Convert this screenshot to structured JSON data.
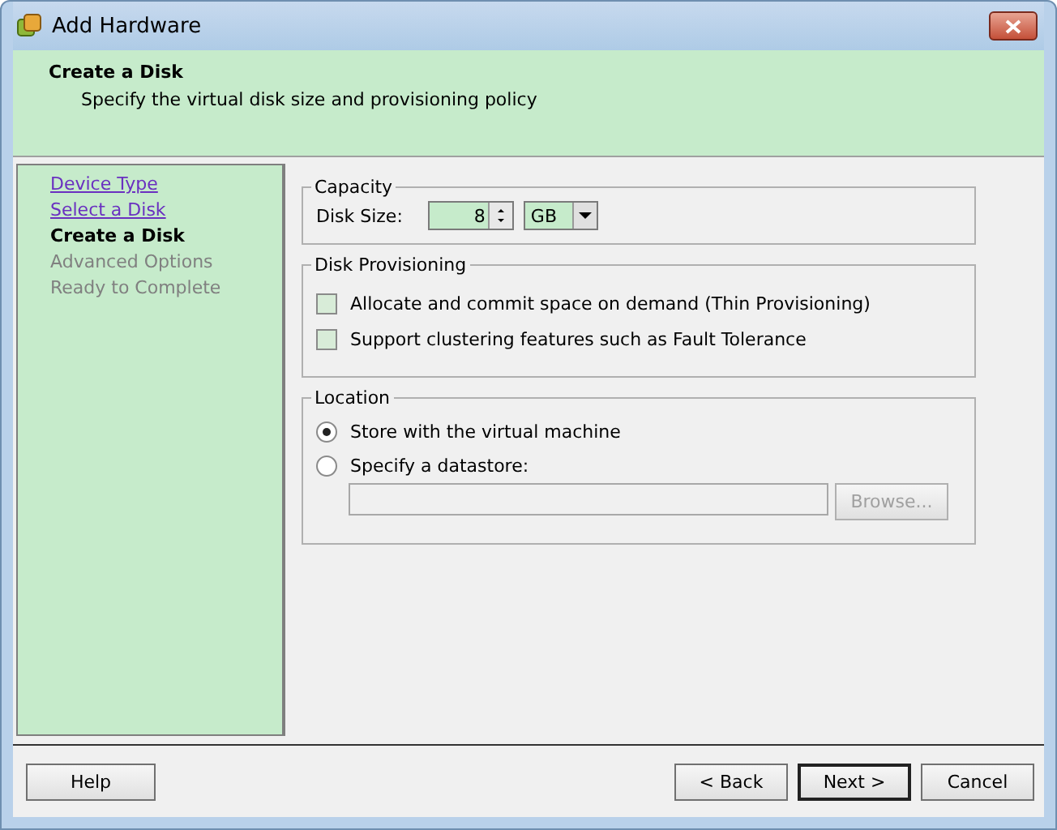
{
  "window": {
    "title": "Add Hardware"
  },
  "header": {
    "title": "Create a Disk",
    "subtitle": "Specify the virtual disk size and provisioning policy"
  },
  "steps": [
    {
      "label": "Device Type",
      "kind": "link"
    },
    {
      "label": "Select a Disk",
      "kind": "link"
    },
    {
      "label": "Create a Disk",
      "kind": "current"
    },
    {
      "label": "Advanced Options",
      "kind": "pending"
    },
    {
      "label": "Ready to Complete",
      "kind": "pending"
    }
  ],
  "capacity": {
    "title": "Capacity",
    "label": "Disk Size:",
    "value": "8",
    "unit": "GB"
  },
  "provisioning": {
    "title": "Disk Provisioning",
    "options": [
      {
        "label": "Allocate and commit space on demand (Thin Provisioning)",
        "checked": false
      },
      {
        "label": "Support clustering features such as Fault Tolerance",
        "checked": false
      }
    ]
  },
  "location": {
    "title": "Location",
    "options": [
      {
        "label": "Store with the virtual machine",
        "selected": true
      },
      {
        "label": "Specify a datastore:",
        "selected": false
      }
    ],
    "datastore_field": {
      "disabled": true
    },
    "browse": {
      "label": "Browse...",
      "disabled": true
    }
  },
  "buttons": {
    "help": "Help",
    "back": "< Back",
    "next": "Next >",
    "cancel": "Cancel"
  }
}
